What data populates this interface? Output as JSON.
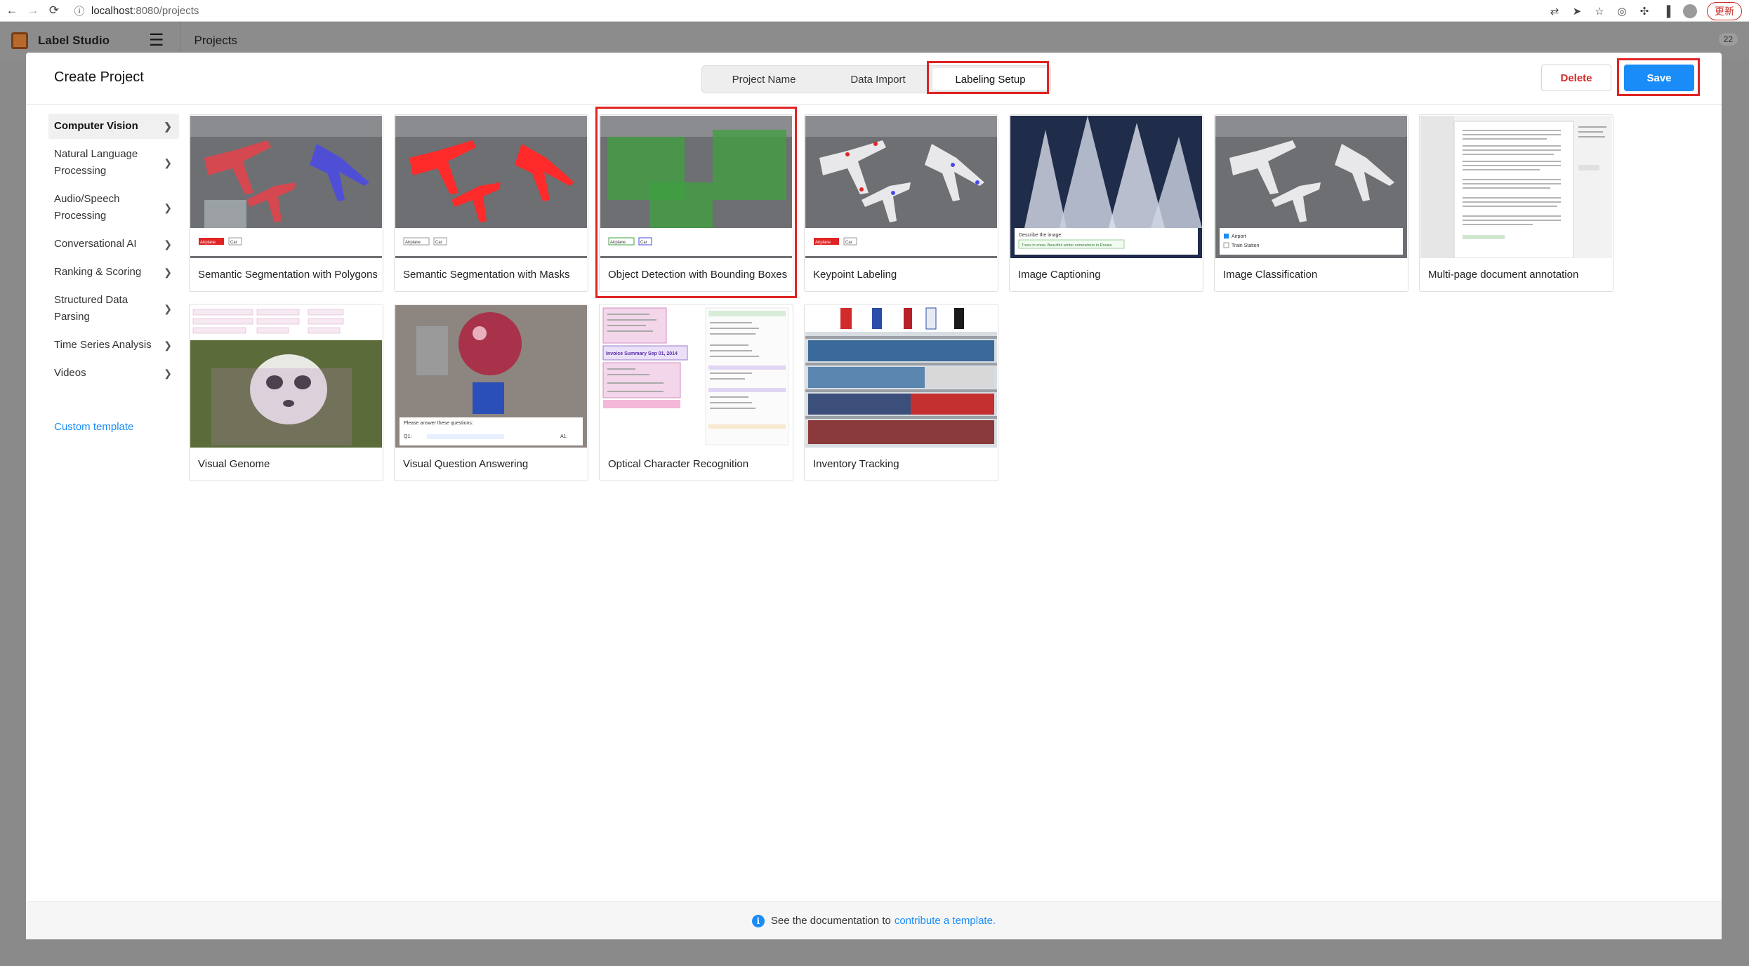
{
  "browser": {
    "url_host": "localhost",
    "url_path": ":8080/projects",
    "update_label": "更新"
  },
  "header": {
    "app_name": "Label Studio",
    "breadcrumb": "Projects",
    "badge": "22"
  },
  "modal": {
    "title": "Create Project",
    "tabs": [
      "Project Name",
      "Data Import",
      "Labeling Setup"
    ],
    "active_tab": "Labeling Setup",
    "delete_label": "Delete",
    "save_label": "Save"
  },
  "sidebar": {
    "items": [
      {
        "label": "Computer Vision",
        "active": true
      },
      {
        "label": "Natural Language Processing"
      },
      {
        "label": "Audio/Speech Processing"
      },
      {
        "label": "Conversational AI"
      },
      {
        "label": "Ranking & Scoring"
      },
      {
        "label": "Structured Data Parsing"
      },
      {
        "label": "Time Series Analysis"
      },
      {
        "label": "Videos"
      }
    ],
    "custom_template": "Custom template"
  },
  "templates": [
    {
      "title": "Semantic Segmentation with Polygons",
      "thumb_labels": [
        "Airplane",
        "Car"
      ]
    },
    {
      "title": "Semantic Segmentation with Masks",
      "thumb_labels": [
        "Airplane",
        "Car"
      ]
    },
    {
      "title": "Object Detection with Bounding Boxes",
      "thumb_labels": [
        "Airplane",
        "Car"
      ],
      "highlighted": true
    },
    {
      "title": "Keypoint Labeling",
      "thumb_labels": [
        "Airplane",
        "Car"
      ]
    },
    {
      "title": "Image Captioning",
      "thumb_labels": [
        "Describe the image:",
        "Trees in snow. Beautiful winter somewhere in Russia"
      ]
    },
    {
      "title": "Image Classification",
      "thumb_labels": [
        "Airport",
        "Train Station"
      ]
    },
    {
      "title": "Multi-page document annotation",
      "thumb_labels": []
    },
    {
      "title": "Visual Genome",
      "thumb_labels": []
    },
    {
      "title": "Visual Question Answering",
      "thumb_labels": [
        "Please answer these questions:",
        "Q1:",
        "A1:"
      ]
    },
    {
      "title": "Optical Character Recognition",
      "thumb_labels": [
        "Invoice Summary Sep 01, 2014"
      ]
    },
    {
      "title": "Inventory Tracking",
      "thumb_labels": []
    }
  ],
  "footer": {
    "text": "See the documentation to",
    "link": "contribute a template."
  },
  "colors": {
    "accent": "#1a8cf7",
    "danger": "#d12b2b",
    "highlight": "#e02424"
  }
}
